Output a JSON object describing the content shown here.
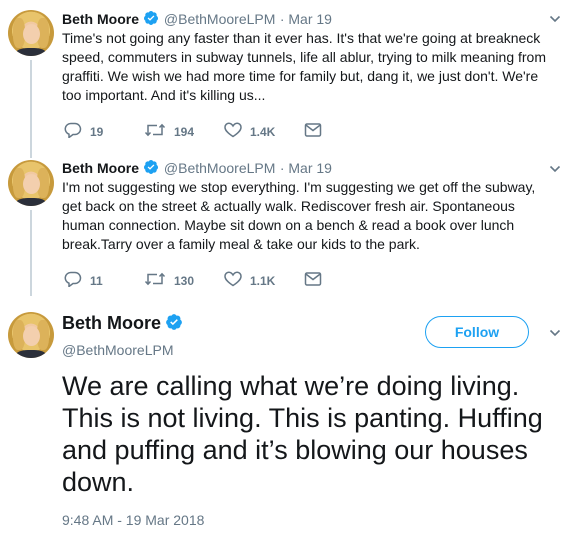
{
  "tweets": [
    {
      "name": "Beth Moore",
      "handle": "@BethMooreLPM",
      "date": "· Mar 19",
      "text": "Time's not going any faster than it ever has. It's that we're going at breakneck speed, commuters in subway tunnels, life all ablur, trying to milk meaning from graffiti. We wish we had more time for family but, dang it, we just don't. We're too important. And it's killing us...",
      "replies": "19",
      "retweets": "194",
      "likes": "1.4K"
    },
    {
      "name": "Beth Moore",
      "handle": "@BethMooreLPM",
      "date": "· Mar 19",
      "text": "I'm not suggesting we stop everything. I'm suggesting we get off the subway, get back on the street & actually walk. Rediscover  fresh air. Spontaneous human connection. Maybe sit down on a bench & read a book over lunch break.Tarry over a family meal & take our kids to the park.",
      "replies": "11",
      "retweets": "130",
      "likes": "1.1K"
    }
  ],
  "main_tweet": {
    "name": "Beth Moore",
    "handle": "@BethMooreLPM",
    "follow_label": "Follow",
    "text": "We are calling what we’re doing living. This is not living. This is panting. Huffing and puffing and it’s blowing our houses down.",
    "timestamp": "9:48 AM - 19 Mar 2018"
  },
  "colors": {
    "accent": "#1da1f2",
    "muted": "#657786",
    "text": "#14171a",
    "thread_line": "#ccd6dd"
  },
  "icons": [
    "verified-badge-icon",
    "chevron-down-icon",
    "reply-icon",
    "retweet-icon",
    "like-icon",
    "direct-message-icon"
  ]
}
